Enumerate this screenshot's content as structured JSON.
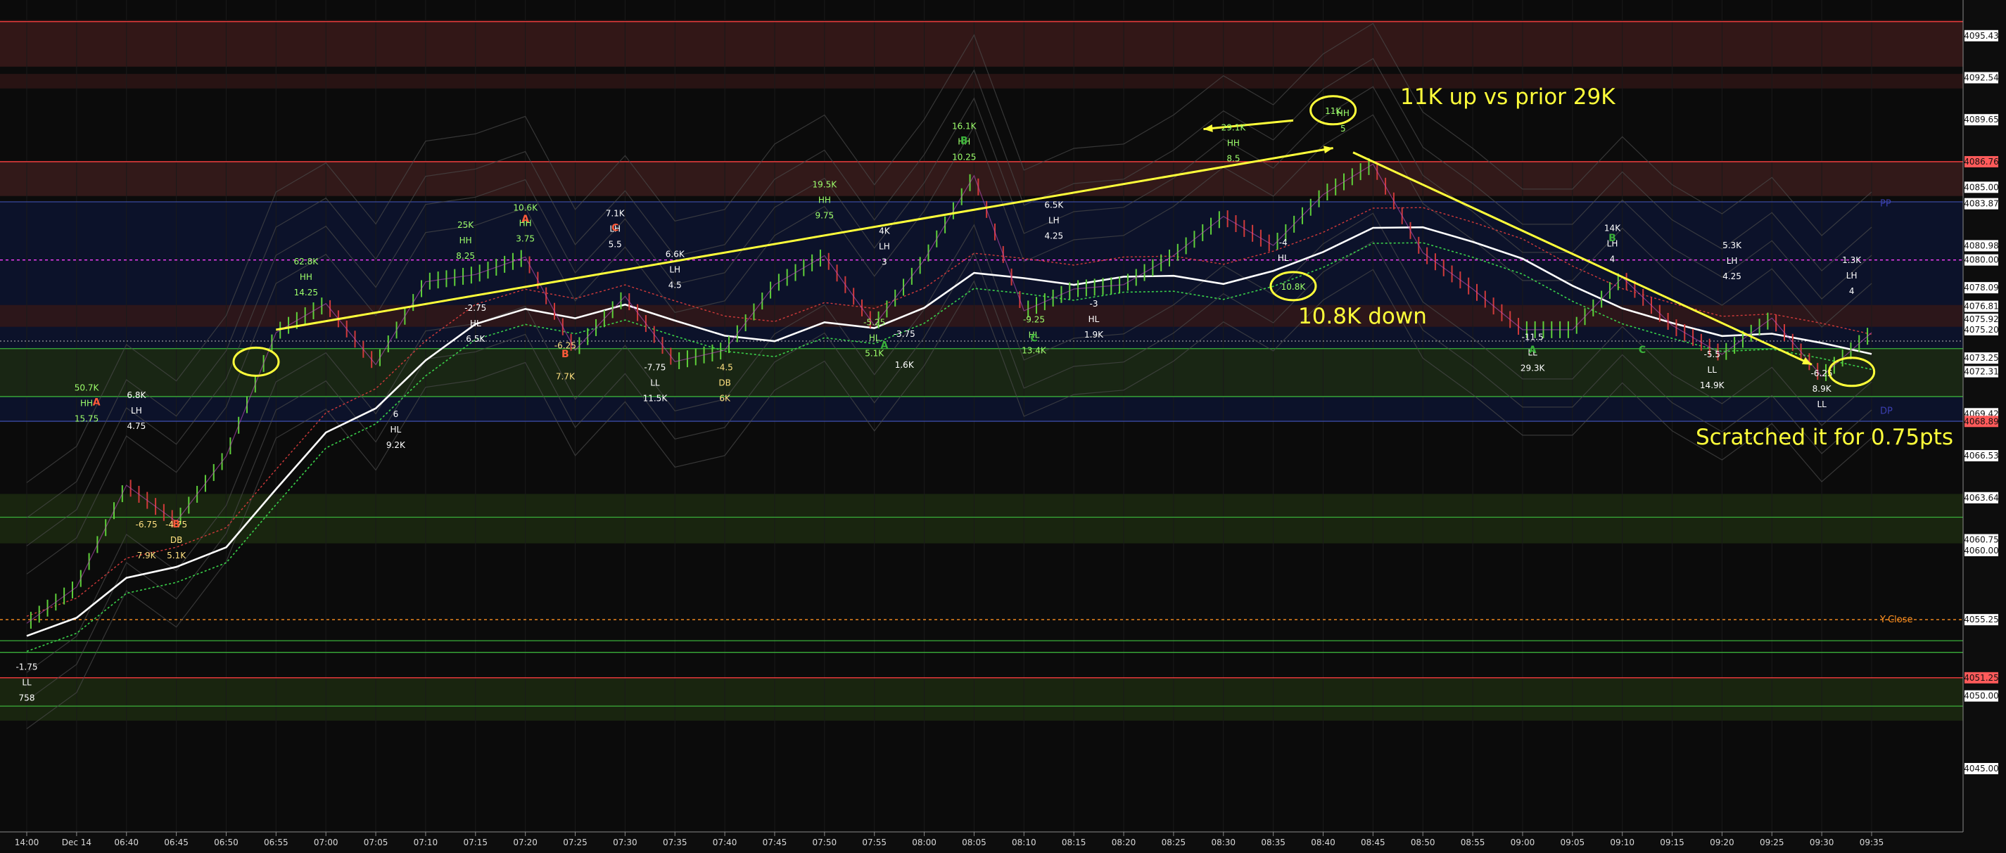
{
  "chart_data": {
    "type": "candlestick",
    "title": "",
    "xlabel": "",
    "ylabel": "",
    "ylim": [
      4042,
      4097.5
    ],
    "x_ticks": [
      "14:00",
      "Dec 14",
      "06:40",
      "06:45",
      "06:50",
      "06:55",
      "07:00",
      "07:05",
      "07:10",
      "07:15",
      "07:20",
      "07:25",
      "07:30",
      "07:35",
      "07:40",
      "07:45",
      "07:50",
      "07:55",
      "08:00",
      "08:05",
      "08:10",
      "08:15",
      "08:20",
      "08:25",
      "08:30",
      "08:35",
      "08:40",
      "08:45",
      "08:50",
      "08:55",
      "09:00",
      "09:05",
      "09:10",
      "09:15",
      "09:20",
      "09:25",
      "09:30",
      "09:35"
    ],
    "y_ticks": [
      "4095.43",
      "4092.54",
      "4089.65",
      "4086.76",
      "4085.00",
      "4083.87",
      "4080.98",
      "4080.00",
      "4078.09",
      "4076.81",
      "4075.92",
      "4075.20",
      "4073.25",
      "4072.31",
      "4069.42",
      "4068.89",
      "4066.53",
      "4063.64",
      "4060.75",
      "4060.00",
      "4055.25",
      "4051.25",
      "4050.00",
      "4045.00"
    ],
    "y_tick_colors": {
      "4086.76": "#ff5a5a",
      "4068.89": "#ff5a5a",
      "4051.25": "#ff5a5a"
    },
    "price_series_approx": [
      {
        "t": "14:00",
        "v": 4055.0
      },
      {
        "t": "Dec 14",
        "v": 4057.5
      },
      {
        "t": "06:40",
        "v": 4064.5
      },
      {
        "t": "06:45",
        "v": 4062.0
      },
      {
        "t": "06:50",
        "v": 4066.5
      },
      {
        "t": "06:55",
        "v": 4075.0
      },
      {
        "t": "07:00",
        "v": 4077.0
      },
      {
        "t": "07:05",
        "v": 4072.8
      },
      {
        "t": "07:10",
        "v": 4078.5
      },
      {
        "t": "07:15",
        "v": 4079.0
      },
      {
        "t": "07:20",
        "v": 4080.2
      },
      {
        "t": "07:25",
        "v": 4073.8
      },
      {
        "t": "07:30",
        "v": 4077.5
      },
      {
        "t": "07:35",
        "v": 4073.0
      },
      {
        "t": "07:40",
        "v": 4073.8
      },
      {
        "t": "07:45",
        "v": 4078.3
      },
      {
        "t": "07:50",
        "v": 4080.3
      },
      {
        "t": "07:55",
        "v": 4075.5
      },
      {
        "t": "08:00",
        "v": 4080.0
      },
      {
        "t": "08:05",
        "v": 4085.8
      },
      {
        "t": "08:10",
        "v": 4076.5
      },
      {
        "t": "08:15",
        "v": 4078.0
      },
      {
        "t": "08:20",
        "v": 4078.3
      },
      {
        "t": "08:25",
        "v": 4080.3
      },
      {
        "t": "08:30",
        "v": 4083.0
      },
      {
        "t": "08:35",
        "v": 4081.0
      },
      {
        "t": "08:40",
        "v": 4084.5
      },
      {
        "t": "08:45",
        "v": 4086.6
      },
      {
        "t": "08:50",
        "v": 4080.5
      },
      {
        "t": "08:55",
        "v": 4078.0
      },
      {
        "t": "09:00",
        "v": 4075.2
      },
      {
        "t": "09:05",
        "v": 4075.2
      },
      {
        "t": "09:10",
        "v": 4078.8
      },
      {
        "t": "09:15",
        "v": 4075.5
      },
      {
        "t": "09:20",
        "v": 4073.5
      },
      {
        "t": "09:25",
        "v": 4076.0
      },
      {
        "t": "09:30",
        "v": 4072.0
      },
      {
        "t": "09:35",
        "v": 4075.0
      }
    ],
    "zones": [
      {
        "from": 4093.3,
        "to": 4096.5,
        "color": "#3a1a1a"
      },
      {
        "from": 4091.8,
        "to": 4092.8,
        "color": "#2e1515"
      },
      {
        "from": 4068.9,
        "to": 4084.0,
        "color": "#0d1430"
      },
      {
        "from": 4070.6,
        "to": 4073.9,
        "color": "#1c2a10"
      },
      {
        "from": 4084.4,
        "to": 4086.8,
        "color": "#3a1c1c"
      },
      {
        "from": 4075.4,
        "to": 4076.9,
        "color": "#331818"
      },
      {
        "from": 4060.5,
        "to": 4063.9,
        "color": "#1c2a10"
      },
      {
        "from": 4048.3,
        "to": 4051.2,
        "color": "#1c2a10"
      }
    ],
    "horizontal_lines": [
      {
        "y": 4096.4,
        "color": "#ff4040"
      },
      {
        "y": 4086.76,
        "color": "#ff4040"
      },
      {
        "y": 4084.0,
        "color": "#3a4aa0"
      },
      {
        "y": 4080.0,
        "color": "#ff40ff",
        "dash": true
      },
      {
        "y": 4068.9,
        "color": "#3a4aa0"
      },
      {
        "y": 4055.25,
        "color": "#ff9020",
        "dash": true
      },
      {
        "y": 4051.25,
        "color": "#ff4040"
      },
      {
        "y": 4053.8,
        "color": "#3ab03a"
      },
      {
        "y": 4053.0,
        "color": "#3ab03a"
      },
      {
        "y": 4049.3,
        "color": "#3ab03a"
      },
      {
        "y": 4062.3,
        "color": "#3ab03a"
      },
      {
        "y": 4073.9,
        "color": "#3ab03a"
      },
      {
        "y": 4070.6,
        "color": "#3ab03a"
      }
    ],
    "zone_labels": [
      {
        "text": "PP",
        "y": 4083.87,
        "color": "#3b3fb0"
      },
      {
        "text": "DP",
        "y": 4069.6,
        "color": "#3b3fb0"
      },
      {
        "text": "Y-Close",
        "y": 4055.25,
        "color": "#ff9020"
      }
    ],
    "trend_lines": [
      {
        "from": [
          "06:55",
          4075.2
        ],
        "to": [
          "08:41",
          4087.7
        ],
        "color": "#ffff3a"
      },
      {
        "from": [
          "08:43",
          4087.4
        ],
        "to": [
          "09:29",
          4072.8
        ],
        "color": "#ffff3a"
      },
      {
        "from": [
          "08:37",
          4089.6
        ],
        "to": [
          "08:28",
          4089.0
        ],
        "color": "#ffff3a"
      }
    ],
    "callouts": [
      {
        "text": "11K up vs prior 29K",
        "color": "#ffff3a"
      },
      {
        "text": "10.8K down",
        "color": "#ffff3a"
      },
      {
        "text": "Scratched it for 0.75pts",
        "color": "#ffff3a"
      }
    ],
    "circle_marks": [
      {
        "t": "08:41",
        "v": 4090.3,
        "label": "11K"
      },
      {
        "t": "08:37",
        "v": 4078.2,
        "label": "10.8K"
      },
      {
        "t": "06:53",
        "v": 4073.0,
        "label": ""
      },
      {
        "t": "09:33",
        "v": 4072.3,
        "label": ""
      }
    ],
    "swing_labels": [
      {
        "t": "14:00",
        "v": 4051.8,
        "lines": [
          "-1.75",
          "LL",
          "758"
        ],
        "color": "#ffffff"
      },
      {
        "t": "06:36",
        "v": 4071.0,
        "lines": [
          "50.7K",
          "HH",
          "15.75"
        ],
        "color": "#9dff6b"
      },
      {
        "t": "06:41",
        "v": 4070.5,
        "lines": [
          "6.8K",
          "LH",
          "4.75"
        ],
        "color": "#ffffff"
      },
      {
        "t": "06:42",
        "v": 4061.6,
        "lines": [
          "-6.75",
          "",
          "7.9K"
        ],
        "color": "#ffe080"
      },
      {
        "t": "06:45",
        "v": 4061.6,
        "lines": [
          "-4.75",
          "DB",
          "5.1K"
        ],
        "color": "#ffe080"
      },
      {
        "t": "06:58",
        "v": 4079.7,
        "lines": [
          "62.8K",
          "HH",
          "14.25"
        ],
        "color": "#9dff6b"
      },
      {
        "t": "07:07",
        "v": 4069.2,
        "lines": [
          "6",
          "HL",
          "9.2K"
        ],
        "color": "#ffffff"
      },
      {
        "t": "07:14",
        "v": 4082.2,
        "lines": [
          "25K",
          "HH",
          "8.25"
        ],
        "color": "#9dff6b"
      },
      {
        "t": "07:15",
        "v": 4076.5,
        "lines": [
          "-2.75",
          "HL",
          "6.5K"
        ],
        "color": "#ffffff"
      },
      {
        "t": "07:20",
        "v": 4083.4,
        "lines": [
          "10.6K",
          "HH",
          "3.75"
        ],
        "color": "#9dff6b"
      },
      {
        "t": "07:24",
        "v": 4073.9,
        "lines": [
          "-6.25",
          "",
          "7.7K"
        ],
        "color": "#ffe080"
      },
      {
        "t": "07:29",
        "v": 4083.0,
        "lines": [
          "7.1K",
          "LH",
          "5.5"
        ],
        "color": "#ffffff"
      },
      {
        "t": "07:33",
        "v": 4072.4,
        "lines": [
          "-7.75",
          "LL",
          "11.5K"
        ],
        "color": "#ffffff"
      },
      {
        "t": "07:35",
        "v": 4080.2,
        "lines": [
          "6.6K",
          "LH",
          "4.5"
        ],
        "color": "#ffffff"
      },
      {
        "t": "07:40",
        "v": 4072.4,
        "lines": [
          "-4.5",
          "DB",
          "6K"
        ],
        "color": "#ffe080"
      },
      {
        "t": "07:50",
        "v": 4085.0,
        "lines": [
          "19.5K",
          "HH",
          "9.75"
        ],
        "color": "#9dff6b"
      },
      {
        "t": "07:55",
        "v": 4075.5,
        "lines": [
          "-5.25",
          "HL",
          "5.1K"
        ],
        "color": "#9dff6b"
      },
      {
        "t": "07:56",
        "v": 4081.8,
        "lines": [
          "4K",
          "LH",
          "3"
        ],
        "color": "#ffffff"
      },
      {
        "t": "07:58",
        "v": 4074.7,
        "lines": [
          "-3.75",
          "",
          "1.6K"
        ],
        "color": "#ffffff"
      },
      {
        "t": "08:04",
        "v": 4089.0,
        "lines": [
          "16.1K",
          "HH",
          "10.25"
        ],
        "color": "#9dff6b"
      },
      {
        "t": "08:11",
        "v": 4075.7,
        "lines": [
          "-9.25",
          "HL",
          "13.4K"
        ],
        "color": "#9dff6b"
      },
      {
        "t": "08:13",
        "v": 4083.6,
        "lines": [
          "6.5K",
          "LH",
          "4.25"
        ],
        "color": "#ffffff"
      },
      {
        "t": "08:17",
        "v": 4076.8,
        "lines": [
          "-3",
          "HL",
          "1.9K"
        ],
        "color": "#ffffff"
      },
      {
        "t": "08:31",
        "v": 4088.9,
        "lines": [
          "29.1K",
          "HH",
          "8.5"
        ],
        "color": "#9dff6b"
      },
      {
        "t": "08:36",
        "v": 4081.0,
        "lines": [
          "-4",
          "HL",
          ""
        ],
        "color": "#ffffff"
      },
      {
        "t": "08:42",
        "v": 4089.9,
        "lines": [
          "HH",
          "5"
        ],
        "color": "#9dff6b"
      },
      {
        "t": "09:01",
        "v": 4074.5,
        "lines": [
          "-11.5",
          "LL",
          "29.3K"
        ],
        "color": "#ffffff"
      },
      {
        "t": "09:09",
        "v": 4082.0,
        "lines": [
          "14K",
          "LH",
          "4"
        ],
        "color": "#ffffff"
      },
      {
        "t": "09:19",
        "v": 4073.3,
        "lines": [
          "-5.5",
          "LL",
          "14.9K"
        ],
        "color": "#ffffff"
      },
      {
        "t": "09:21",
        "v": 4080.8,
        "lines": [
          "5.3K",
          "LH",
          "4.25"
        ],
        "color": "#ffffff"
      },
      {
        "t": "09:30",
        "v": 4072.0,
        "lines": [
          "-6.25",
          "8.9K",
          "LL"
        ],
        "color": "#ffffff"
      },
      {
        "t": "09:33",
        "v": 4079.8,
        "lines": [
          "1.3K",
          "LH",
          "4"
        ],
        "color": "#ffffff"
      }
    ],
    "marker_letters": [
      {
        "t": "06:37",
        "v": 4070.0,
        "text": "A",
        "color": "#ff5a3a"
      },
      {
        "t": "06:45",
        "v": 4061.6,
        "text": "B",
        "color": "#ff5a3a"
      },
      {
        "t": "07:20",
        "v": 4082.6,
        "text": "A",
        "color": "#ff5a3a"
      },
      {
        "t": "07:29",
        "v": 4082.0,
        "text": "C",
        "color": "#ff5a3a"
      },
      {
        "t": "07:24",
        "v": 4073.3,
        "text": "B",
        "color": "#ff5a3a"
      },
      {
        "t": "08:04",
        "v": 4088.0,
        "text": "B",
        "color": "#3ab03a"
      },
      {
        "t": "08:11",
        "v": 4074.4,
        "text": "C",
        "color": "#3ab03a"
      },
      {
        "t": "07:56",
        "v": 4073.9,
        "text": "A",
        "color": "#3ab03a"
      },
      {
        "t": "09:09",
        "v": 4081.3,
        "text": "B",
        "color": "#3ab03a"
      },
      {
        "t": "09:01",
        "v": 4073.6,
        "text": "A",
        "color": "#3ab03a"
      },
      {
        "t": "09:12",
        "v": 4073.6,
        "text": "C",
        "color": "#3ab03a"
      }
    ]
  }
}
